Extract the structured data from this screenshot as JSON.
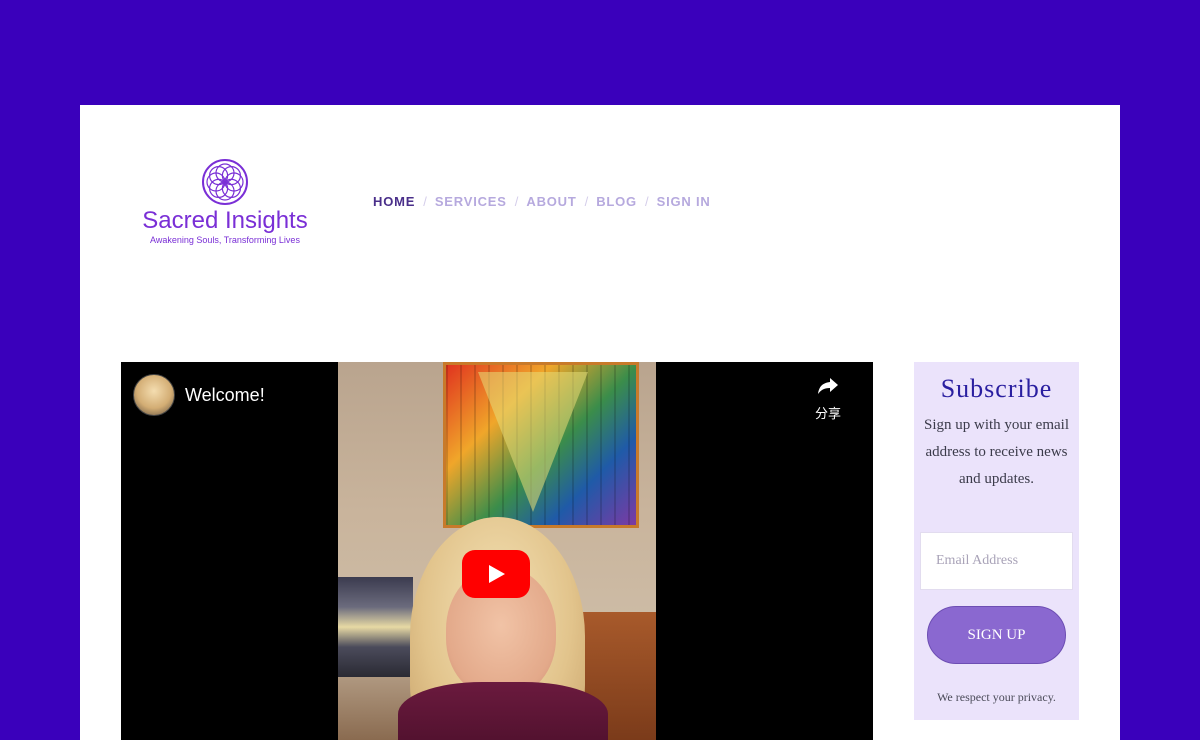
{
  "site": {
    "name": "Sacred Insights",
    "tagline": "Awakening Souls, Transforming Lives",
    "logo_icon": "flower-of-life-icon"
  },
  "nav": {
    "items": [
      {
        "label": "HOME",
        "active": true
      },
      {
        "label": "SERVICES",
        "active": false
      },
      {
        "label": "ABOUT",
        "active": false
      },
      {
        "label": "BLOG",
        "active": false
      },
      {
        "label": "SIGN IN",
        "active": false
      }
    ]
  },
  "video": {
    "title": "Welcome!",
    "share_label": "分享",
    "play_icon": "youtube-play-icon",
    "share_icon": "share-arrow-icon"
  },
  "subscribe": {
    "title": "Subscribe",
    "text": "Sign up with your email address to receive news and updates.",
    "email_placeholder": "Email Address",
    "button_label": "SIGN UP",
    "privacy": "We respect your privacy."
  },
  "colors": {
    "background": "#3a00bb",
    "brand": "#7a2fd6",
    "nav_active": "#4a2f8a",
    "nav_inactive": "#b6a9de",
    "subscribe_bg": "#ebe3fb",
    "button": "#8a68d0",
    "youtube_red": "#ff0000"
  }
}
